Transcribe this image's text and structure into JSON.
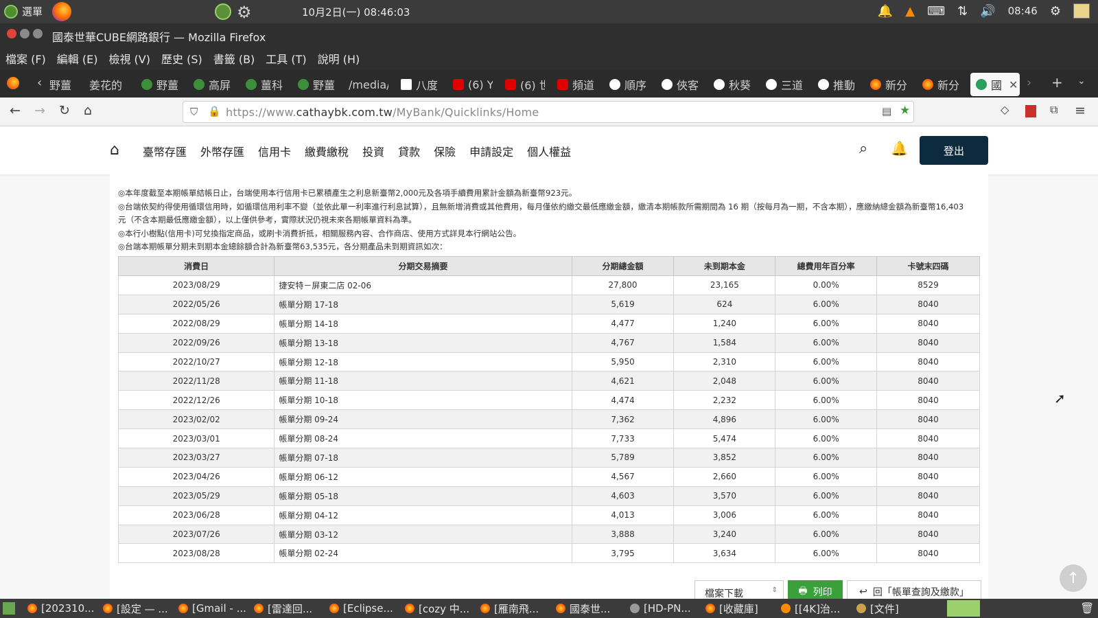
{
  "system": {
    "menu_label": "選單",
    "clock": "10月2日(一) 08:46:03",
    "tray_time": "08:46"
  },
  "window": {
    "title": "國泰世華CUBE網路銀行 — Mozilla Firefox"
  },
  "menubar": [
    "檔案 (F)",
    "編輯 (E)",
    "檢視 (V)",
    "歷史 (S)",
    "書籤 (B)",
    "工具 (T)",
    "說明 (H)"
  ],
  "tabs": [
    {
      "label": "野薑",
      "color": "#5a8f3a"
    },
    {
      "label": "姜花的",
      "color": ""
    },
    {
      "label": "野薑",
      "color": "#3c8f3a"
    },
    {
      "label": "高屏",
      "color": "#3c8f3a"
    },
    {
      "label": "薑科",
      "color": "#3c8f3a"
    },
    {
      "label": "野薑",
      "color": "#3c8f3a"
    },
    {
      "label": "/media/",
      "color": ""
    },
    {
      "label": "八度",
      "color": "#ffffff"
    },
    {
      "label": "(6) Y",
      "color": "#e00000"
    },
    {
      "label": "(6) 世",
      "color": "#e00000"
    },
    {
      "label": "頻道",
      "color": "#e00000"
    },
    {
      "label": "順序",
      "color": "#ffffff"
    },
    {
      "label": "俠客",
      "color": "#ffffff"
    },
    {
      "label": "秋葵",
      "color": "#ffffff"
    },
    {
      "label": "三道",
      "color": "#ffffff"
    },
    {
      "label": "推動",
      "color": "#ffffff"
    },
    {
      "label": "新分",
      "color": "#ff7a1a"
    },
    {
      "label": "新分",
      "color": "#ff7a1a"
    },
    {
      "label": "國",
      "color": "#2aa05a"
    }
  ],
  "navbar": {
    "url_prefix": "https://www.",
    "url_domain": "cathaybk.com.tw",
    "url_path": "/MyBank/Quicklinks/Home"
  },
  "site": {
    "nav": [
      "臺幣存匯",
      "外幣存匯",
      "信用卡",
      "繳費繳稅",
      "投資",
      "貸款",
      "保險",
      "申請設定",
      "個人權益"
    ],
    "logout": "登出"
  },
  "notes": [
    "◎本年度截至本期帳單結帳日止，台端使用本行信用卡已累積產生之利息新臺幣2,000元及各項手續費用累計金額為新臺幣923元。",
    "◎台端依契約得使用循環信用時，如循環信用利率不變（並依此單一利率進行利息試算），且無新增消費或其他費用，每月僅依約繳交最低應繳金額，繳清本期帳款所需期間為 16 期（按每月為一期，不含本期），應繳納總金額為新臺幣16,403 元（不含本期最低應繳金額），以上僅供參考，實際狀況仍視未來各期帳單資料為準。",
    "◎本行小樹點(信用卡)可兌換指定商品，或刷卡消費折抵，相關服務內容、合作商店、使用方式詳見本行網站公告。",
    "◎台端本期帳單分期未到期本金總餘額合計為新臺幣63,535元，各分期產品未到期資訊如次："
  ],
  "table": {
    "headers": [
      "消費日",
      "分期交易摘要",
      "分期總金額",
      "未到期本金",
      "總費用年百分率",
      "卡號末四碼"
    ],
    "rows": [
      [
        "2023/08/29",
        "捷安特－屏東二店 02-06",
        "27,800",
        "23,165",
        "0.00%",
        "8529"
      ],
      [
        "2022/05/26",
        "帳單分期 17-18",
        "5,619",
        "624",
        "6.00%",
        "8040"
      ],
      [
        "2022/08/29",
        "帳單分期 14-18",
        "4,477",
        "1,240",
        "6.00%",
        "8040"
      ],
      [
        "2022/09/26",
        "帳單分期 13-18",
        "4,767",
        "1,584",
        "6.00%",
        "8040"
      ],
      [
        "2022/10/27",
        "帳單分期 12-18",
        "5,950",
        "2,310",
        "6.00%",
        "8040"
      ],
      [
        "2022/11/28",
        "帳單分期 11-18",
        "4,621",
        "2,048",
        "6.00%",
        "8040"
      ],
      [
        "2022/12/26",
        "帳單分期 10-18",
        "4,474",
        "2,232",
        "6.00%",
        "8040"
      ],
      [
        "2023/02/02",
        "帳單分期 09-24",
        "7,362",
        "4,896",
        "6.00%",
        "8040"
      ],
      [
        "2023/03/01",
        "帳單分期 08-24",
        "7,733",
        "5,474",
        "6.00%",
        "8040"
      ],
      [
        "2023/03/27",
        "帳單分期 07-18",
        "5,789",
        "3,852",
        "6.00%",
        "8040"
      ],
      [
        "2023/04/26",
        "帳單分期 06-12",
        "4,567",
        "2,660",
        "6.00%",
        "8040"
      ],
      [
        "2023/05/29",
        "帳單分期 05-18",
        "4,603",
        "3,570",
        "6.00%",
        "8040"
      ],
      [
        "2023/06/28",
        "帳單分期 04-12",
        "4,013",
        "3,006",
        "6.00%",
        "8040"
      ],
      [
        "2023/07/26",
        "帳單分期 03-12",
        "3,888",
        "3,240",
        "6.00%",
        "8040"
      ],
      [
        "2023/08/28",
        "帳單分期 02-24",
        "3,795",
        "3,634",
        "6.00%",
        "8040"
      ]
    ]
  },
  "controls": {
    "file_download": "檔案下載",
    "print": "列印",
    "back": "回「帳單查詢及繳款」"
  },
  "taskbar": [
    {
      "label": "[202310...",
      "icon": "firefox"
    },
    {
      "label": "[設定 — ...",
      "icon": "firefox"
    },
    {
      "label": "[Gmail - ...",
      "icon": "firefox"
    },
    {
      "label": "[雷達回...",
      "icon": "firefox"
    },
    {
      "label": "[Eclipse...",
      "icon": "firefox"
    },
    {
      "label": "[cozy 中...",
      "icon": "firefox"
    },
    {
      "label": "[雁南飛...",
      "icon": "firefox"
    },
    {
      "label": "國泰世...",
      "icon": "firefox"
    },
    {
      "label": "[HD-PN...",
      "icon": "drive"
    },
    {
      "label": "[收藏庫]",
      "icon": "firefox"
    },
    {
      "label": "[[4K]治...",
      "icon": "vlc"
    },
    {
      "label": "[文件]",
      "icon": "folder"
    }
  ]
}
